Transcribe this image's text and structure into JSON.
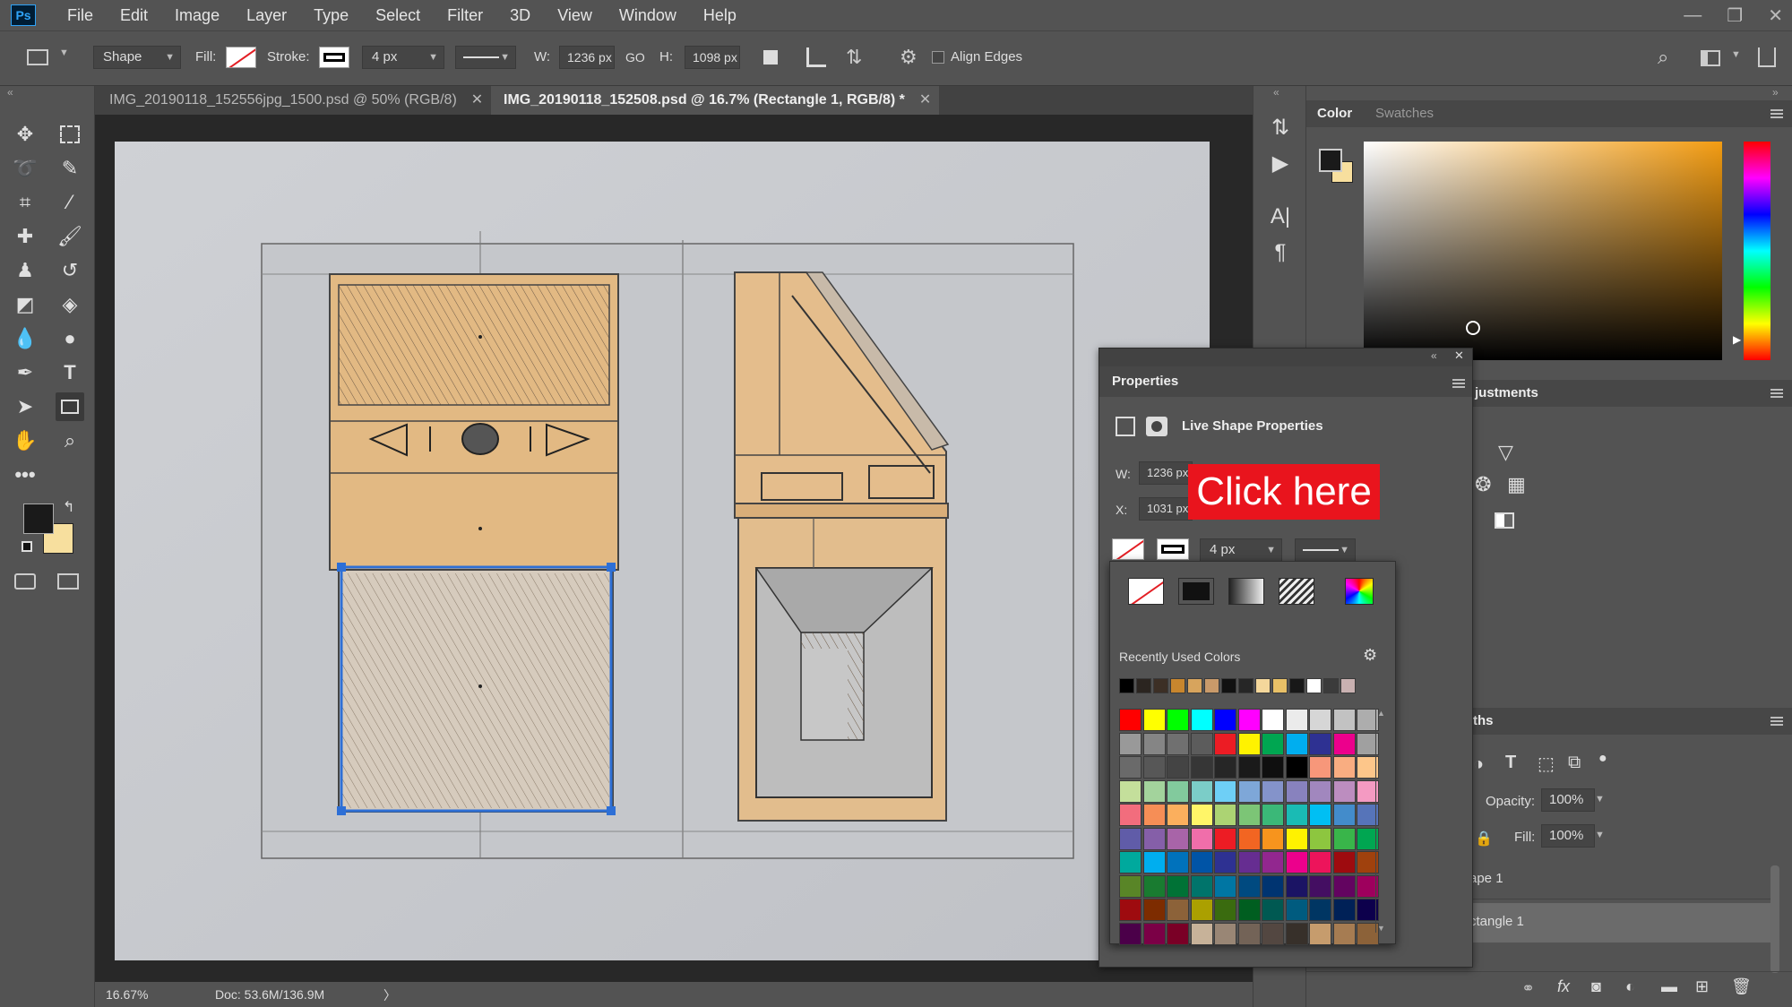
{
  "app": {
    "logo": "Ps"
  },
  "menu": [
    "File",
    "Edit",
    "Image",
    "Layer",
    "Type",
    "Select",
    "Filter",
    "3D",
    "View",
    "Window",
    "Help"
  ],
  "window_controls": {
    "minimize": "—",
    "restore": "❐",
    "close": "✕"
  },
  "options": {
    "shape_mode": "Shape",
    "fill_label": "Fill:",
    "stroke_label": "Stroke:",
    "stroke_width": "4 px",
    "w_label": "W:",
    "w_value": "1236 px",
    "link_icon": "GO",
    "h_label": "H:",
    "h_value": "1098 px",
    "align_edges": "Align Edges"
  },
  "tabs": [
    {
      "label": "IMG_20190118_152556jpg_1500.psd @ 50% (RGB/8)",
      "active": false
    },
    {
      "label": "IMG_20190118_152508.psd @ 16.7% (Rectangle 1, RGB/8) *",
      "active": true
    }
  ],
  "status": {
    "zoom": "16.67%",
    "doc": "Doc: 53.6M/136.9M",
    "arrow": "〉"
  },
  "right_panels": {
    "color_tab": "Color",
    "swatches_tab": "Swatches",
    "adjustments_tab": "justments",
    "paths_tab": "ths",
    "opacity_label": "Opacity:",
    "opacity_value": "100%",
    "fill_label": "Fill:",
    "fill_value": "100%",
    "layer_1": "ape 1",
    "layer_2": "ctangle 1"
  },
  "properties": {
    "title": "Properties",
    "subtitle": "Live Shape Properties",
    "w_label": "W:",
    "w_value": "1236 px",
    "x_label": "X:",
    "x_value": "1031 px",
    "stroke_width": "4 px"
  },
  "picker": {
    "recent_label": "Recently Used Colors",
    "recent_colors": [
      "#000000",
      "#2b2520",
      "#3c2f25",
      "#c8862e",
      "#d7a45d",
      "#c99a6a",
      "#111111",
      "#262626",
      "#f4d79b",
      "#e8c067",
      "#181818",
      "#ffffff",
      "#3b3b3b",
      "#c9b1b1"
    ],
    "grid_rows": [
      [
        "#ff0000",
        "#ffff00",
        "#00ff00",
        "#00ffff",
        "#0000ff",
        "#ff00ff",
        "#ffffff",
        "#ebebeb",
        "#d6d6d6",
        "#c2c2c2",
        "#adadad"
      ],
      [
        "#999999",
        "#858585",
        "#707070",
        "#5c5c5c",
        "#ec1c24",
        "#fff200",
        "#00a651",
        "#00aeef",
        "#2e3192",
        "#ec008c",
        "#a0a0a0"
      ],
      [
        "#6a6a6a",
        "#575757",
        "#444444",
        "#363636",
        "#262626",
        "#1a1a1a",
        "#0f0f0f",
        "#000000",
        "#f7977a",
        "#f9ad81",
        "#fdc68a"
      ],
      [
        "#c4df9b",
        "#a3d39c",
        "#82ca9d",
        "#7bcdc8",
        "#6ecff6",
        "#7ea7d8",
        "#8493ca",
        "#8882be",
        "#a187be",
        "#bc8dbf",
        "#f49ac2"
      ],
      [
        "#f26d7d",
        "#f68e56",
        "#fbaf5d",
        "#fff568",
        "#acd373",
        "#7cc576",
        "#3bb878",
        "#1abbb4",
        "#00bff3",
        "#438ccb",
        "#5674b9"
      ],
      [
        "#605ca8",
        "#855fa8",
        "#a864a8",
        "#f06eaa",
        "#ed1c24",
        "#f26522",
        "#f7941d",
        "#fff200",
        "#8dc63f",
        "#39b54a",
        "#00a651"
      ],
      [
        "#00a99d",
        "#00aeef",
        "#0072bc",
        "#0054a6",
        "#2e3192",
        "#662d91",
        "#92278f",
        "#ec008c",
        "#ed145b",
        "#9e0b0f",
        "#a0410d"
      ],
      [
        "#598527",
        "#197b30",
        "#007236",
        "#00746b",
        "#0076a3",
        "#004a80",
        "#003471",
        "#1b1464",
        "#440e62",
        "#630460",
        "#9e005d"
      ],
      [
        "#9e0b0f",
        "#7d2c00",
        "#8c6239",
        "#aba000",
        "#3a6b0f",
        "#005e20",
        "#005952",
        "#005b7f",
        "#003663",
        "#002157",
        "#0d004c"
      ],
      [
        "#4b0049",
        "#7b0046",
        "#7a0026",
        "#c7b299",
        "#998675",
        "#736357",
        "#534741",
        "#37302a",
        "#c69c6d",
        "#a67c52",
        "#8c6239"
      ]
    ]
  },
  "colors": {
    "accent": "#e9141d",
    "panel": "#535353",
    "selection": "#2d6fd6"
  },
  "overlay": {
    "cta": "Click here"
  }
}
